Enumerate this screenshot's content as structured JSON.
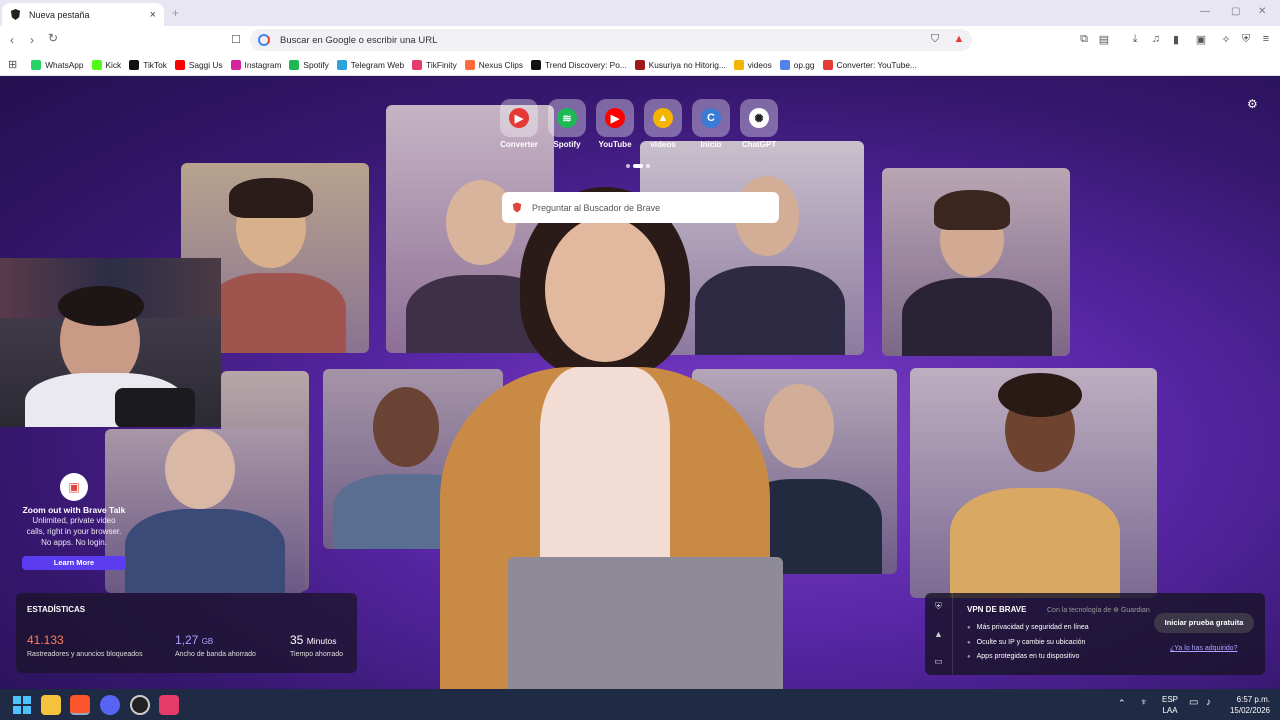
{
  "tab": {
    "title": "Nueva pestaña",
    "close": "×",
    "new": "+"
  },
  "window": {
    "min": "—",
    "max": "▢",
    "close": "✕"
  },
  "toolbar": {
    "url_placeholder": "Buscar en Google o escribir una URL"
  },
  "bookmarks": [
    {
      "label": "WhatsApp",
      "color": "#25d366"
    },
    {
      "label": "Kick",
      "color": "#53fc18"
    },
    {
      "label": "TikTok",
      "color": "#111111"
    },
    {
      "label": "Saggi Us",
      "color": "#ff0000"
    },
    {
      "label": "Instagram",
      "color": "#d6249f"
    },
    {
      "label": "Spotify",
      "color": "#1db954"
    },
    {
      "label": "Telegram Web",
      "color": "#2aa3df"
    },
    {
      "label": "TikFinity",
      "color": "#e53b6a"
    },
    {
      "label": "Nexus Clips",
      "color": "#ff6a3d"
    },
    {
      "label": "Trend Discovery: Po...",
      "color": "#111111"
    },
    {
      "label": "Kusuriya no Hitorig...",
      "color": "#a01818"
    },
    {
      "label": "videos",
      "color": "#f4b400"
    },
    {
      "label": "op.gg",
      "color": "#5383e8"
    },
    {
      "label": "Converter: YouTube...",
      "color": "#e53935"
    }
  ],
  "topsites": [
    {
      "label": "Converter",
      "color": "#e53935",
      "glyph": "▶"
    },
    {
      "label": "Spotify",
      "color": "#1db954",
      "glyph": "≋"
    },
    {
      "label": "YouTube",
      "color": "#ff0000",
      "glyph": "▶"
    },
    {
      "label": "videos",
      "color": "#f4b400",
      "glyph": "▲"
    },
    {
      "label": "Inicio",
      "color": "#3a7bd5",
      "glyph": "C"
    },
    {
      "label": "ChatGPT",
      "color": "#ffffff",
      "glyph": "✺"
    }
  ],
  "search": {
    "placeholder": "Preguntar al Buscador de Brave"
  },
  "talk": {
    "title": "Zoom out with Brave Talk",
    "desc1": "Unlimited, private video",
    "desc2": "calls, right in your browser.",
    "desc3": "No apps. No login.",
    "button": "Learn More"
  },
  "stats": {
    "title": "ESTADÍSTICAS",
    "trackers_value": "41.133",
    "trackers_label": "Rastreadores y anuncios bloqueados",
    "bandwidth_value": "1,27",
    "bandwidth_unit": "GB",
    "bandwidth_label": "Ancho de banda ahorrado",
    "time_value": "35",
    "time_unit": "Minutos",
    "time_label": "Tiempo ahorrado"
  },
  "vpn": {
    "title": "VPN DE BRAVE",
    "sub": "Con la tecnología de ⊕ Guardian",
    "items": [
      "Más privacidad y seguridad en línea",
      "Oculte su IP y cambie su ubicación",
      "Apps protegidas en tu dispositivo"
    ],
    "trial": "Iniciar prueba gratuita",
    "link": "¿Ya lo has adquirido?"
  },
  "taskbar": {
    "lang1": "ESP",
    "lang2": "LAA",
    "time": "6:57 p.m.",
    "date": "15/02/2026"
  }
}
